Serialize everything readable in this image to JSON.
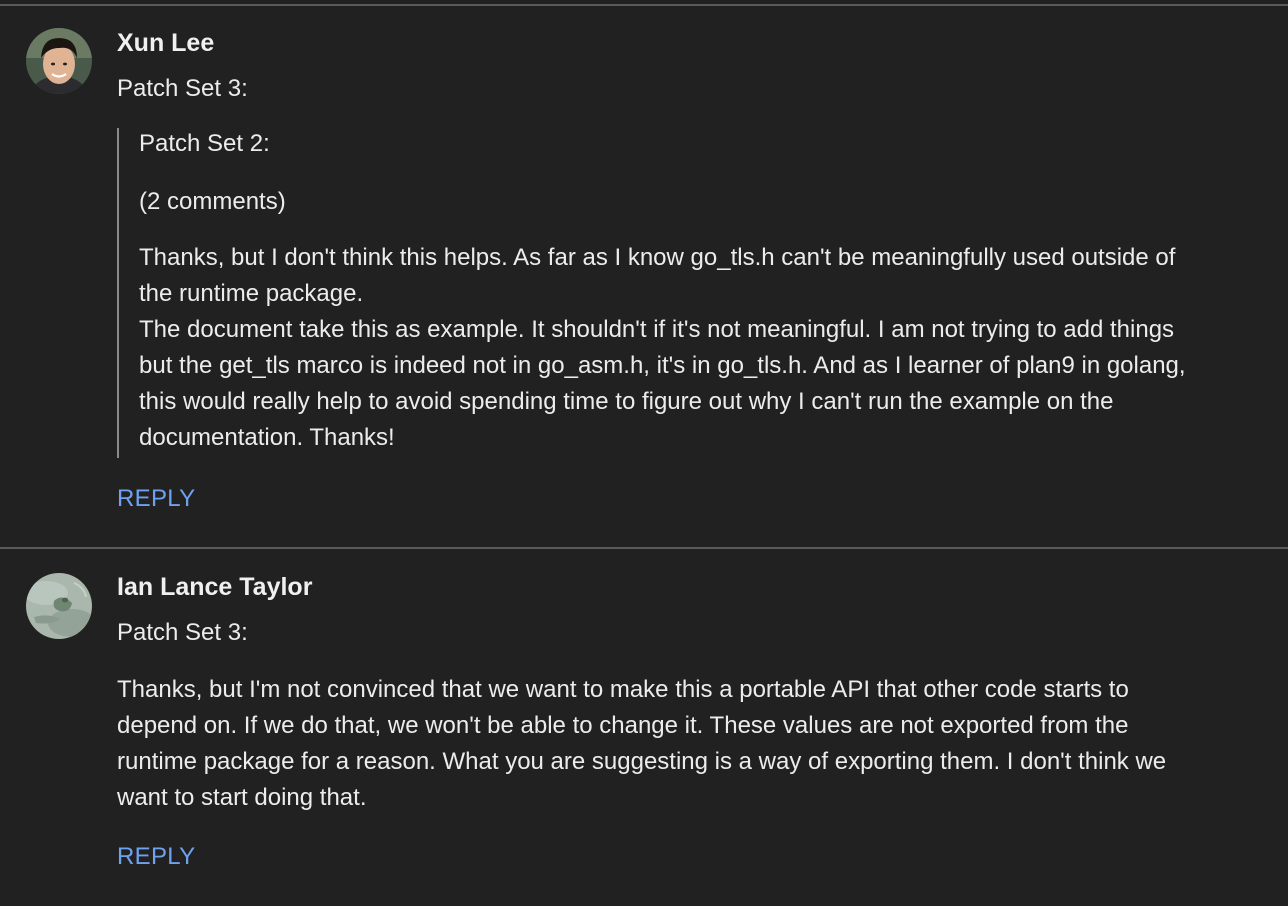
{
  "comments": [
    {
      "author": "Xun Lee",
      "avatar_icon": "person-photo-avatar",
      "patchset": "Patch Set 3:",
      "quote": {
        "patchset": "Patch Set 2:",
        "comments_count": "(2 comments)",
        "lines": [
          "Thanks, but I don't think this helps.  As far as I know go_tls.h can't be meaningfully used outside of",
          "the runtime package.",
          "The document take this as example. It shouldn't if it's not meaningful. I am not trying to add things",
          "but the get_tls marco is indeed not in go_asm.h, it's in go_tls.h. And as I learner of plan9 in golang,",
          "this would really help to avoid spending time to figure out why I can't run the example on the",
          "documentation. Thanks!"
        ]
      },
      "reply_label": "REPLY"
    },
    {
      "author": "Ian Lance Taylor",
      "avatar_icon": "frog-photo-avatar",
      "patchset": "Patch Set 3:",
      "lines": [
        "Thanks, but I'm not convinced that we want to make this a portable API that other code starts to",
        "depend on.  If we do that, we won't be able to change it.  These values are not exported from the",
        "runtime package for a reason.  What you are suggesting is a way of exporting them.  I don't think we",
        "want to start doing that."
      ],
      "reply_label": "REPLY"
    }
  ],
  "colors": {
    "background": "#212121",
    "text": "#ececec",
    "link": "#6fa2ee",
    "divider": "#5a5a5a"
  }
}
